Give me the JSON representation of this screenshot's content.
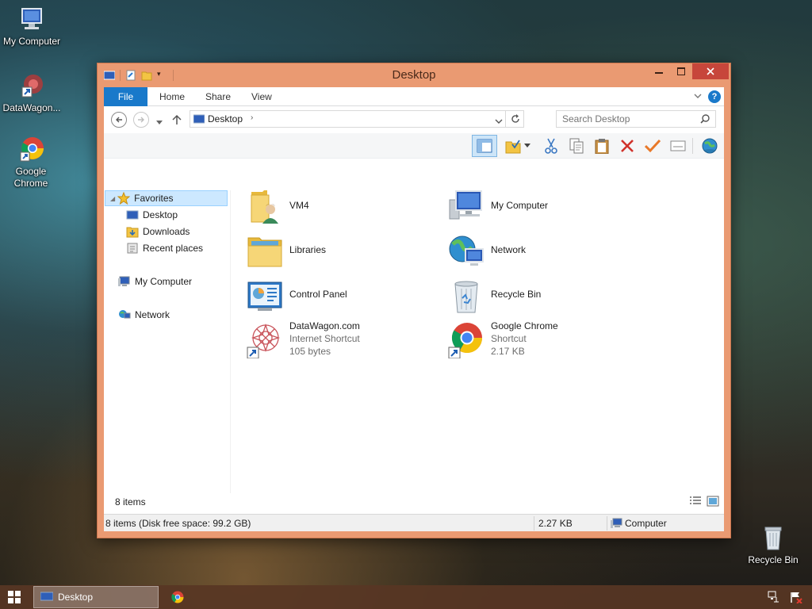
{
  "desktop": {
    "icons": [
      {
        "label": "My Computer"
      },
      {
        "label": "DataWagon..."
      },
      {
        "label": "Google Chrome"
      },
      {
        "label": "Recycle Bin"
      }
    ]
  },
  "window": {
    "title": "Desktop",
    "ribbon_tabs": [
      "File",
      "Home",
      "Share",
      "View"
    ],
    "address": {
      "current": "Desktop"
    },
    "search": {
      "placeholder": "Search Desktop"
    },
    "nav": {
      "favorites": "Favorites",
      "favorites_children": [
        "Desktop",
        "Downloads",
        "Recent places"
      ],
      "my_computer": "My Computer",
      "network": "Network"
    },
    "files": [
      {
        "name": "VM4",
        "icon": "user-folder-icon"
      },
      {
        "name": "My Computer",
        "icon": "computer-icon"
      },
      {
        "name": "Libraries",
        "icon": "libraries-icon"
      },
      {
        "name": "Network",
        "icon": "network-icon"
      },
      {
        "name": "Control Panel",
        "icon": "control-panel-icon"
      },
      {
        "name": "Recycle Bin",
        "icon": "recycle-bin-icon"
      },
      {
        "name": "DataWagon.com",
        "type": "Internet Shortcut",
        "size": "105 bytes",
        "icon": "datawagon-icon"
      },
      {
        "name": "Google Chrome",
        "type": "Shortcut",
        "size": "2.17 KB",
        "icon": "chrome-icon"
      }
    ],
    "item_count": "8 items",
    "status": {
      "left": "8 items (Disk free space: 99.2 GB)",
      "size": "2.27 KB",
      "location": "Computer"
    }
  },
  "taskbar": {
    "active_window": "Desktop"
  },
  "colors": {
    "accent": "#1979ca",
    "titlebar": "#ea9a72",
    "close": "#c7463b",
    "taskbar": "#583624"
  }
}
